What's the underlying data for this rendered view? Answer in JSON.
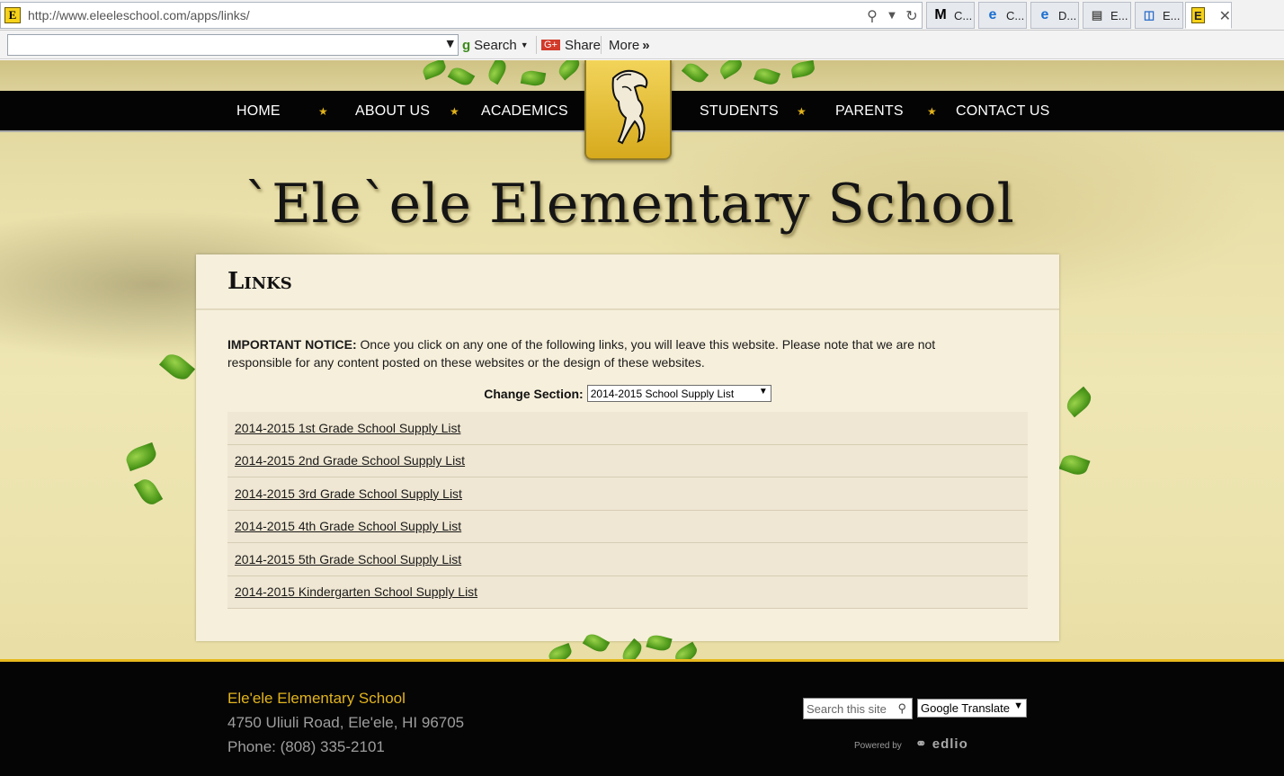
{
  "browser": {
    "url": "http://www.eleeleschool.com/apps/links/",
    "tabs": [
      {
        "label": "C...",
        "icon": "im-icon"
      },
      {
        "label": "C...",
        "icon": "ie-icon"
      },
      {
        "label": "D...",
        "icon": "ie-icon"
      },
      {
        "label": "E...",
        "icon": "page-icon"
      },
      {
        "label": "E...",
        "icon": "window-icon"
      },
      {
        "label": "",
        "icon": "site-e-icon",
        "active": true
      }
    ],
    "favicon_letter": "E",
    "toolbar": {
      "search_label": "Search",
      "share_label": "Share",
      "more_label": "More"
    }
  },
  "site": {
    "nav": [
      "HOME",
      "ABOUT US",
      "ACADEMICS",
      "STUDENTS",
      "PARENTS",
      "CONTACT US"
    ],
    "nav_star": "★",
    "title": "`Ele`ele Elementary School",
    "accent_color": "#e2b41c"
  },
  "content": {
    "heading": "Links",
    "notice_label": "IMPORTANT NOTICE:",
    "notice_text": " Once you click on any one of the following links, you will leave this website. Please note that we are not responsible for any content posted on these websites or the design of these websites.",
    "change_section_label": "Change Section:",
    "change_section_value": "2014-2015 School Supply List",
    "links": [
      "2014-2015 1st Grade School Supply List",
      "2014-2015 2nd Grade School Supply List",
      "2014-2015 3rd Grade School Supply List",
      "2014-2015 4th Grade School Supply List",
      "2014-2015 5th Grade School Supply List",
      "2014-2015 Kindergarten School Supply List"
    ]
  },
  "footer": {
    "school_name": "Ele'ele Elementary School",
    "address": "4750 Uliuli Road, Ele'ele, HI 96705",
    "phone": "Phone: (808) 335-2101",
    "search_placeholder": "Search this site",
    "translate_value": "Google Translate",
    "powered_by": "Powered by",
    "edlio": "edlio"
  }
}
